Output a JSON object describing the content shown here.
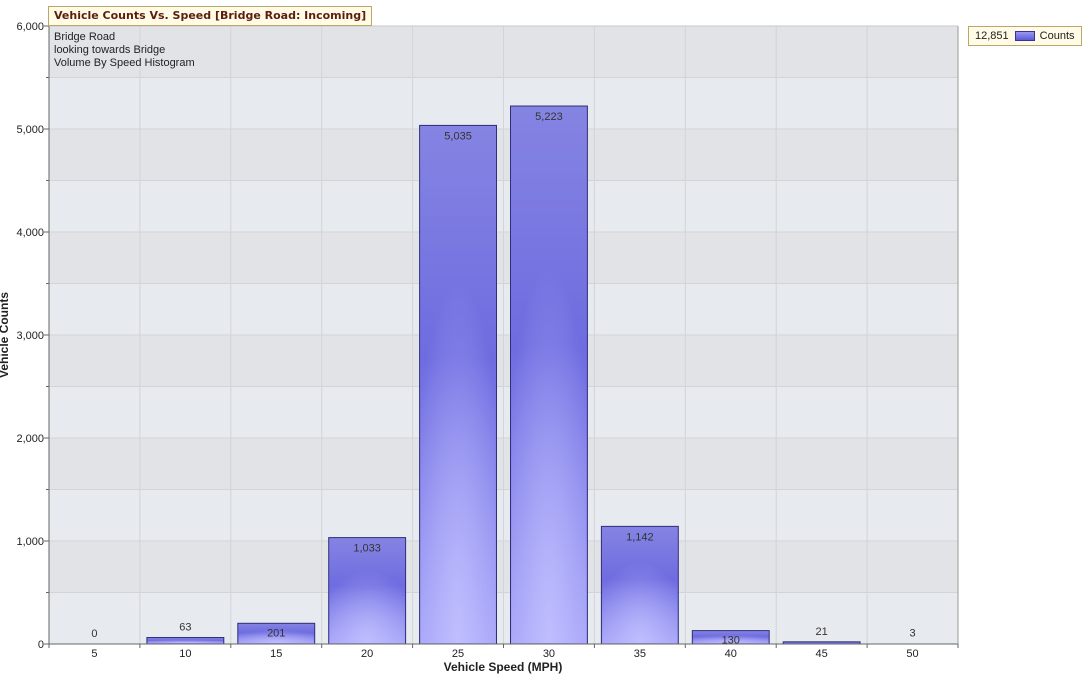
{
  "chart_data": {
    "type": "bar",
    "title": "Vehicle Counts Vs. Speed [Bridge Road: Incoming]",
    "notes": [
      "Bridge Road",
      "looking towards Bridge",
      "Volume By Speed Histogram"
    ],
    "xlabel": "Vehicle Speed (MPH)",
    "ylabel": "Vehicle Counts",
    "categories": [
      "5",
      "10",
      "15",
      "20",
      "25",
      "30",
      "35",
      "40",
      "45",
      "50"
    ],
    "series": [
      {
        "name": "Counts",
        "values": [
          0,
          63,
          201,
          1033,
          5035,
          5223,
          1142,
          130,
          21,
          3
        ]
      }
    ],
    "data_labels": [
      "0",
      "63",
      "201",
      "1,033",
      "5,035",
      "5,223",
      "1,142",
      "130",
      "21",
      "3"
    ],
    "yticks": [
      "0",
      "1,000",
      "2,000",
      "3,000",
      "4,000",
      "5,000",
      "6,000"
    ],
    "ylim": [
      0,
      6000
    ],
    "grid": true,
    "legend": {
      "position": "top-right",
      "total": "12,851",
      "label": "Counts"
    },
    "colors": {
      "bar_light": "#a3a1f7",
      "bar_dark": "#6b69e0",
      "bar_edge": "#2e2e7a",
      "plot_band_a": "#e7eaee",
      "plot_band_b": "#e2e3e7"
    }
  }
}
